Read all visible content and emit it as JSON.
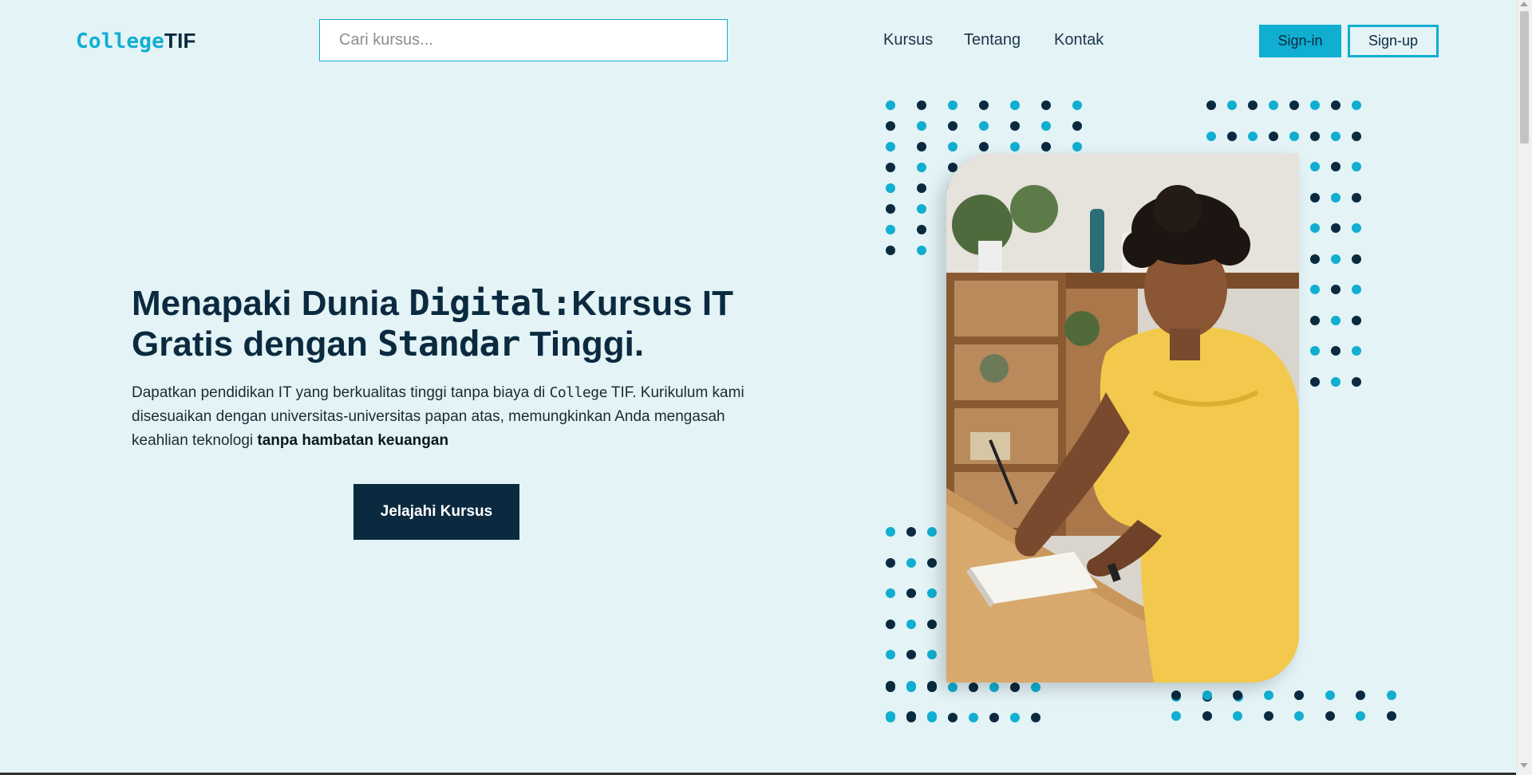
{
  "header": {
    "logo_part1": "College",
    "logo_part2": "TIF",
    "search_placeholder": "Cari kursus...",
    "nav": [
      "Kursus",
      "Tentang",
      "Kontak"
    ],
    "signin_label": "Sign-in",
    "signup_label": "Sign-up"
  },
  "hero": {
    "title_a": "Menapaki Dunia ",
    "title_b": "Digital:",
    "title_c": "Kursus IT Gratis dengan ",
    "title_d": "Standar",
    "title_e": " Tinggi.",
    "desc_a": "Dapatkan pendidikan IT yang berkualitas tinggi tanpa biaya di ",
    "desc_b": "College",
    "desc_c": " TIF. Kurikulum kami disesuaikan dengan universitas-universitas papan atas, memungkinkan Anda mengasah keahlian teknologi ",
    "desc_d": "tanpa hambatan keuangan",
    "cta_label": "Jelajahi Kursus"
  },
  "colors": {
    "accent": "#10aed1",
    "dark": "#0b2a3f",
    "background": "#e3f3f6"
  },
  "illustration": {
    "image": "student-writing-photo"
  }
}
